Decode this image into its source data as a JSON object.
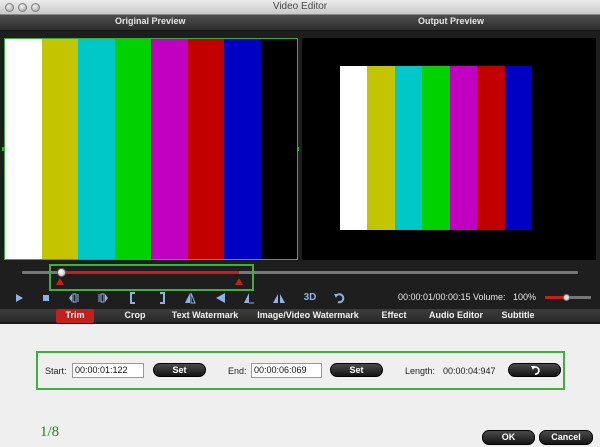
{
  "window": {
    "title": "Video Editor"
  },
  "headers": {
    "original": "Original Preview",
    "output": "Output Preview"
  },
  "colors": {
    "accent": "#c21f1f",
    "highlight": "#3db03d",
    "bars": [
      "#ffffff",
      "#c5c400",
      "#00c8c8",
      "#00d200",
      "#c200c2",
      "#c20000",
      "#0000c5",
      "#000000"
    ]
  },
  "playback": {
    "time": "00:00:01/00:00:15",
    "volume_label": "Volume:",
    "volume_value": "100%",
    "volume_level": 1.0,
    "three_d_label": "3D"
  },
  "tabs": [
    {
      "label": "Trim",
      "active": true
    },
    {
      "label": "Crop"
    },
    {
      "label": "Text Watermark"
    },
    {
      "label": "Image/Video Watermark"
    },
    {
      "label": "Effect"
    },
    {
      "label": "Audio Editor"
    },
    {
      "label": "Subtitle"
    }
  ],
  "trim": {
    "start_label": "Start:",
    "start_value": "00:00:01:122",
    "set_label": "Set",
    "end_label": "End:",
    "end_value": "00:00:06:069",
    "length_label": "Length:",
    "length_value": "00:00:04:947"
  },
  "icons": {
    "play": "play-icon",
    "stop": "stop-icon",
    "prev_frame": "prev-frame-icon",
    "next_frame": "next-frame-icon",
    "mark_in": "mark-in-icon",
    "mark_out": "mark-out-icon",
    "flip_v": "flip-vertical-icon",
    "rotate_left": "rotate-left-icon",
    "rotate_right": "rotate-right-icon",
    "flip_h": "flip-horizontal-icon",
    "undo": "undo-icon",
    "reset": "reset-icon"
  },
  "footer": {
    "page_indicator": "1/8",
    "ok_label": "OK",
    "cancel_label": "Cancel"
  }
}
